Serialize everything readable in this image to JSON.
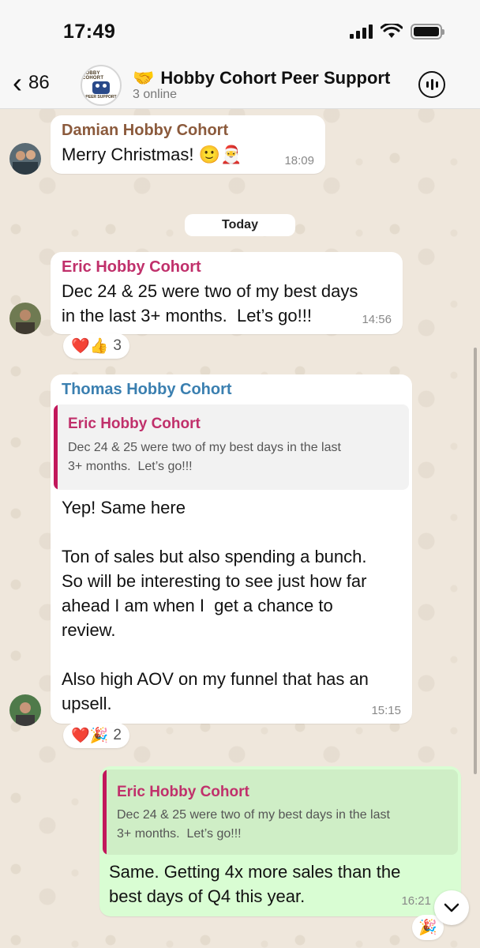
{
  "status_bar": {
    "time": "17:49"
  },
  "header": {
    "back_count": "86",
    "avatar_top": "HOBBY COHORT",
    "avatar_bottom": "PEER SUPPORT",
    "title_emoji": "🤝",
    "title": "Hobby Cohort Peer Support",
    "subtitle": "3 online"
  },
  "date_separator": "Today",
  "messages": [
    {
      "sender": "Damian Hobby Cohort",
      "sender_color": "#8b5a3c",
      "text": "Merry Christmas! 🙂🎅",
      "time": "18:09"
    },
    {
      "sender": "Eric Hobby Cohort",
      "sender_color": "#c0306b",
      "text": "Dec 24 & 25 were two of my best days\nin the last 3+ months.  Let’s go!!!",
      "time": "14:56",
      "reactions": {
        "emojis": "❤️👍",
        "count": "3"
      }
    },
    {
      "sender": "Thomas Hobby Cohort",
      "sender_color": "#3a7fb0",
      "quote": {
        "sender": "Eric Hobby Cohort",
        "text": "Dec 24 & 25 were two of my best days in the last\n3+ months.  Let’s go!!!"
      },
      "text": "Yep! Same here\n\nTon of sales but also spending a bunch.\nSo will be interesting to see just how far\nahead I am when I  get a chance to\nreview.\n\nAlso high AOV on my funnel that has an\nupsell.",
      "time": "15:15",
      "reactions": {
        "emojis": "❤️🎉",
        "count": "2"
      }
    },
    {
      "outgoing": true,
      "quote": {
        "sender": "Eric Hobby Cohort",
        "text": "Dec 24 & 25 were two of my best days in the last\n3+ months.  Let’s go!!!"
      },
      "text": "Same. Getting 4x more sales than the\nbest days of Q4 this year.",
      "time": "16:21",
      "reactions": {
        "emojis": "🎉"
      }
    }
  ],
  "colors": {
    "outgoing_bubble": "#d9fdd3",
    "quote_accent": "#c2185b"
  },
  "icons": [
    "back-chevron-icon",
    "group-call-icon",
    "scroll-down-icon"
  ]
}
